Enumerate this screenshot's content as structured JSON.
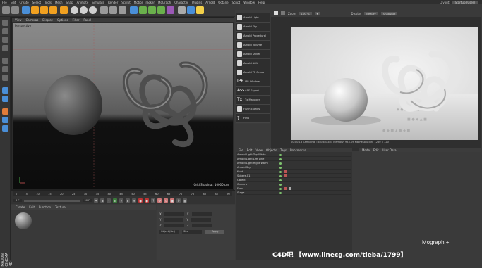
{
  "menubar": {
    "items": [
      "File",
      "Edit",
      "Create",
      "Select",
      "Tools",
      "Mesh",
      "Snap",
      "Animate",
      "Simulate",
      "Render",
      "Sculpt",
      "Motion Tracker",
      "MoGraph",
      "Character",
      "Plugins",
      "Arnold",
      "Octane",
      "Script",
      "Window",
      "Help"
    ],
    "layout_label": "Layout:",
    "layout_value": "Startup (User)"
  },
  "toolbar": {
    "icons": [
      "undo-icon",
      "redo-icon",
      "select-icon",
      "move-icon",
      "scale-icon",
      "rotate-icon",
      "axis-x-icon",
      "axis-y-icon",
      "axis-z-icon",
      "coord-icon",
      "render-region-icon",
      "render-view-icon",
      "render-settings-icon",
      "cube-icon",
      "pen-icon",
      "subdiv-icon",
      "array-icon",
      "deformer-icon",
      "floor-icon",
      "camera-icon",
      "light-icon"
    ]
  },
  "viewport": {
    "menu": [
      "View",
      "Cameras",
      "Display",
      "Options",
      "Filter",
      "Panel"
    ],
    "label": "Perspective",
    "grid_spacing": "Grid Spacing : 10000 cm"
  },
  "arnold_menu": {
    "items": [
      "Arnold Light",
      "Arnold Sky",
      "Arnold Procedural",
      "Arnold Volume",
      "Arnold Driver",
      "Arnold AOV",
      "Arnold TP Group",
      "IPR Window",
      "ASS Export",
      "Tx Manager",
      "Flush caches",
      "Help"
    ]
  },
  "ipr": {
    "zoom_label": "Zoom",
    "zoom_value": "100 %",
    "display_label": "Display",
    "display_value": "Beauty",
    "snapshot_label": "Snapshot",
    "status": "00:00:13  Sampling: [3/3/3/3/3/3]  Memory: 983.19 MB  Resolution: 1280 x 720"
  },
  "object_manager": {
    "menu": [
      "File",
      "Edit",
      "View",
      "Objects",
      "Tags",
      "Bookmarks"
    ],
    "objects": [
      {
        "name": "Arnold Light Top White"
      },
      {
        "name": "Arnold Light Left Line"
      },
      {
        "name": "Arnold Light Right Warm"
      },
      {
        "name": "Arnold Sky"
      },
      {
        "name": "Knot"
      },
      {
        "name": "Sphere.01"
      },
      {
        "name": "Object"
      },
      {
        "name": "Camera"
      },
      {
        "name": "Floor"
      },
      {
        "name": "Stage"
      }
    ]
  },
  "attributes": {
    "menu": [
      "Mode",
      "Edit",
      "User Data"
    ]
  },
  "timeline": {
    "ticks": [
      "0",
      "5",
      "10",
      "15",
      "20",
      "25",
      "30",
      "35",
      "40",
      "45",
      "50",
      "55",
      "60",
      "65",
      "70",
      "75",
      "80",
      "85",
      "90"
    ],
    "current": "0 F",
    "end": "90 F"
  },
  "material_manager": {
    "menu": [
      "Create",
      "Edit",
      "Function",
      "Texture"
    ]
  },
  "coordinates": {
    "apply_label": "Apply",
    "object_label": "Object (Rel)",
    "size_label": "Size"
  },
  "watermark": {
    "text": "C4D吧 【www.linecg.com/tieba/1799】"
  },
  "mograph": {
    "text": "Mograph +"
  },
  "brand": {
    "text": "MAXON CINEMA 4D"
  },
  "colors": {
    "accent": "#f0a020",
    "panel": "#3a3a3a",
    "bg": "#2b2b2b"
  }
}
